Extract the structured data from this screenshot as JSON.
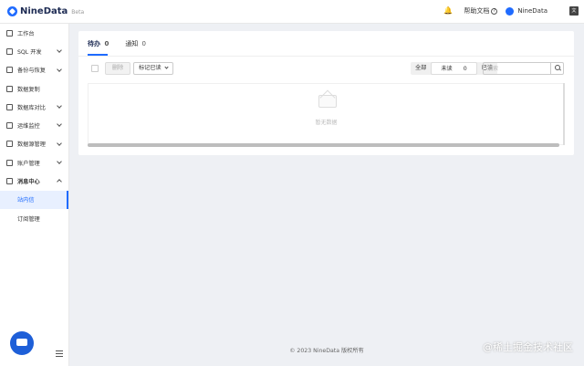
{
  "header": {
    "brand": "NineData",
    "beta": "Beta",
    "help_label": "帮助文档",
    "user_name": "NineData",
    "lang_icon": "translate-icon"
  },
  "sidebar": {
    "items": [
      {
        "label": "工作台",
        "icon": "home-icon"
      },
      {
        "label": "SQL 开发",
        "icon": "sql-icon"
      },
      {
        "label": "备份与恢复",
        "icon": "backup-icon"
      },
      {
        "label": "数据复制",
        "icon": "copy-icon"
      },
      {
        "label": "数据库对比",
        "icon": "compare-icon"
      },
      {
        "label": "运维监控",
        "icon": "monitor-icon"
      },
      {
        "label": "数据源管理",
        "icon": "datasource-icon"
      },
      {
        "label": "账户管理",
        "icon": "account-icon"
      },
      {
        "label": "消息中心",
        "icon": "message-icon"
      }
    ],
    "sub_items": [
      {
        "label": "站内信"
      },
      {
        "label": "订阅管理"
      }
    ]
  },
  "tabs": [
    {
      "label": "待办",
      "count": "0"
    },
    {
      "label": "通知",
      "count": "0"
    }
  ],
  "toolbar": {
    "delete_label": "删除",
    "mark_read_label": "标记已读",
    "filter_all": "全部",
    "filter_unread": "未读",
    "filter_unread_count": "0",
    "filter_read": "已读",
    "search_placeholder": "搜索"
  },
  "empty": {
    "text": "暂无数据"
  },
  "footer": {
    "copyright": "© 2023 NineData 版权所有"
  },
  "watermark": "@稀土掘金技术社区",
  "colors": {
    "accent": "#1f6bff",
    "chat_button": "#1e5fd8",
    "background": "#eef0f4"
  }
}
